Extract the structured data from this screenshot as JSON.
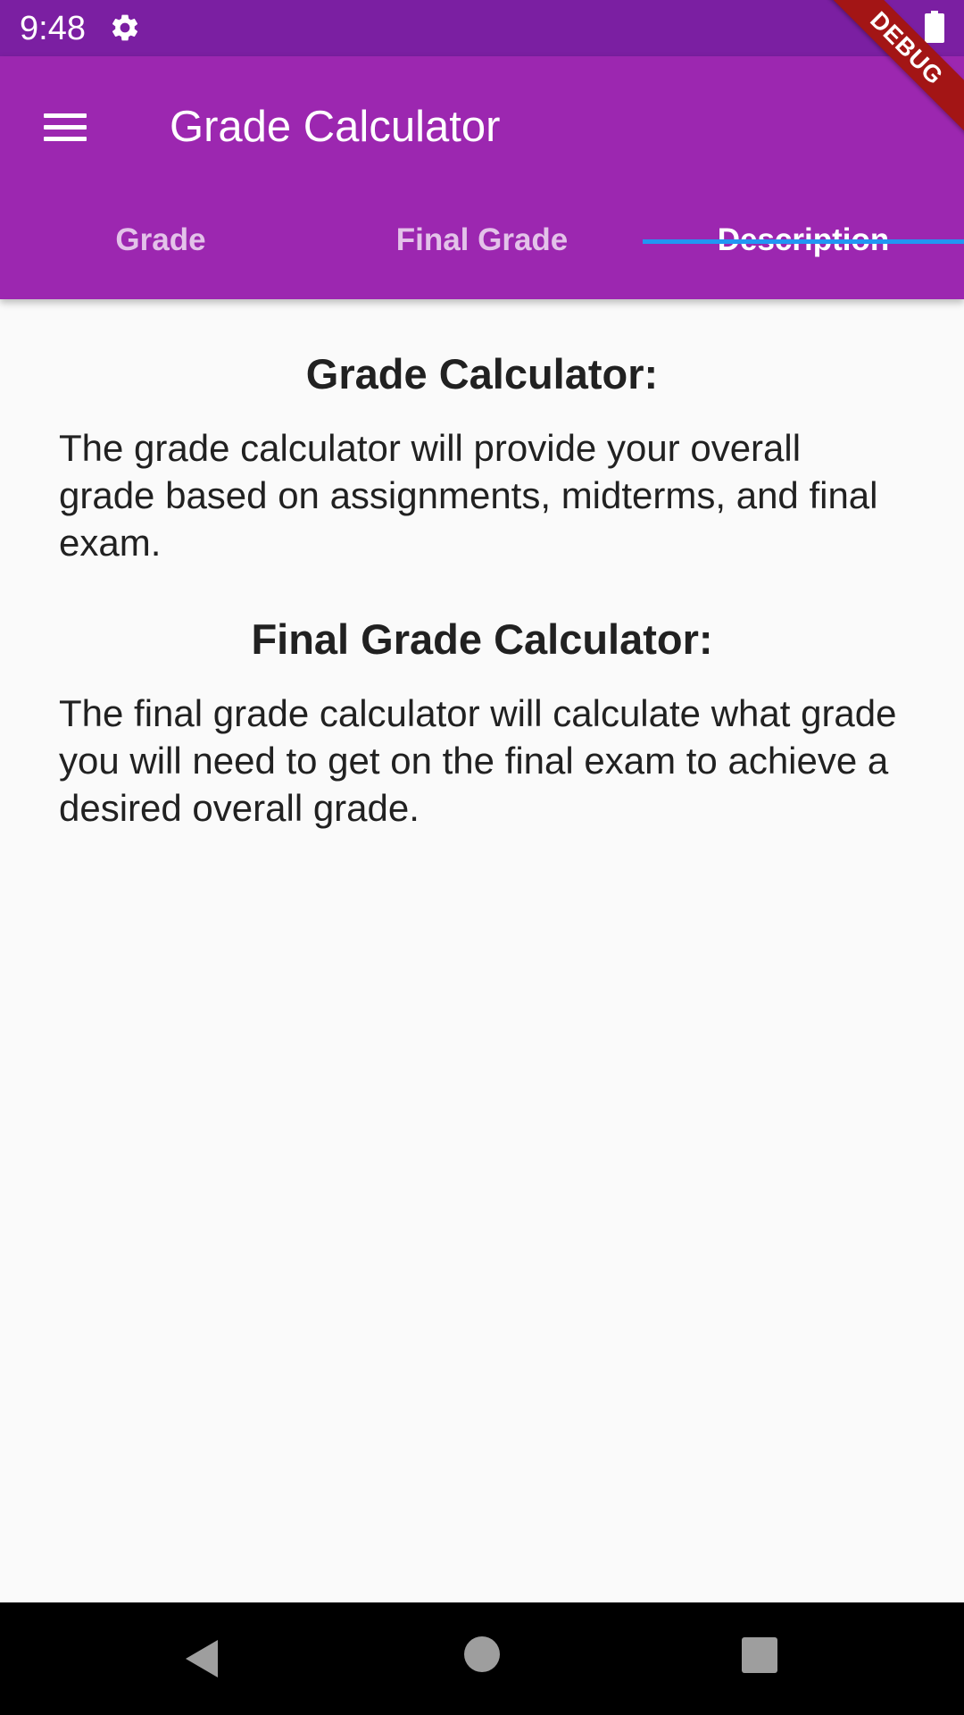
{
  "status_bar": {
    "time": "9:48",
    "icons": [
      "gear-icon",
      "battery-icon"
    ]
  },
  "app_bar": {
    "title": "Grade Calculator",
    "menu_icon": "hamburger-menu-icon",
    "background_color": "#9c27b0",
    "status_bar_color": "#7b1fa2"
  },
  "tabs": [
    {
      "label": "Grade",
      "active": false
    },
    {
      "label": "Final Grade",
      "active": false
    },
    {
      "label": "Description",
      "active": true
    }
  ],
  "tab_indicator_color": "#2196f3",
  "debug_banner": "DEBUG",
  "content": {
    "sections": [
      {
        "title": "Grade Calculator:",
        "text": "The grade calculator will provide your overall grade based on assignments, midterms, and final exam."
      },
      {
        "title": "Final Grade Calculator:",
        "text": "The final grade calculator will calculate what grade you will need to get on the final exam to achieve a desired overall grade."
      }
    ]
  },
  "nav_bar": {
    "icons": [
      "back-icon",
      "home-icon",
      "recents-icon"
    ]
  }
}
